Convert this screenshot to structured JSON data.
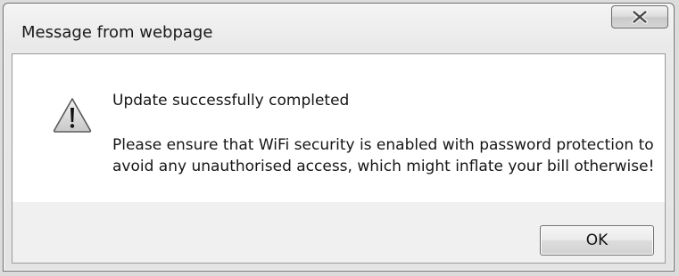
{
  "window": {
    "title": "Message from webpage"
  },
  "title_bar": {
    "close_icon": "close-x-icon"
  },
  "message": {
    "icon": "warning-triangle-icon",
    "heading": "Update successfully completed",
    "body_lines": [
      "Please ensure that WiFi security is enabled with password protection to",
      "avoid any unauthorised access, which might inflate your bill otherwise!"
    ]
  },
  "buttons": {
    "ok_label": "OK"
  }
}
